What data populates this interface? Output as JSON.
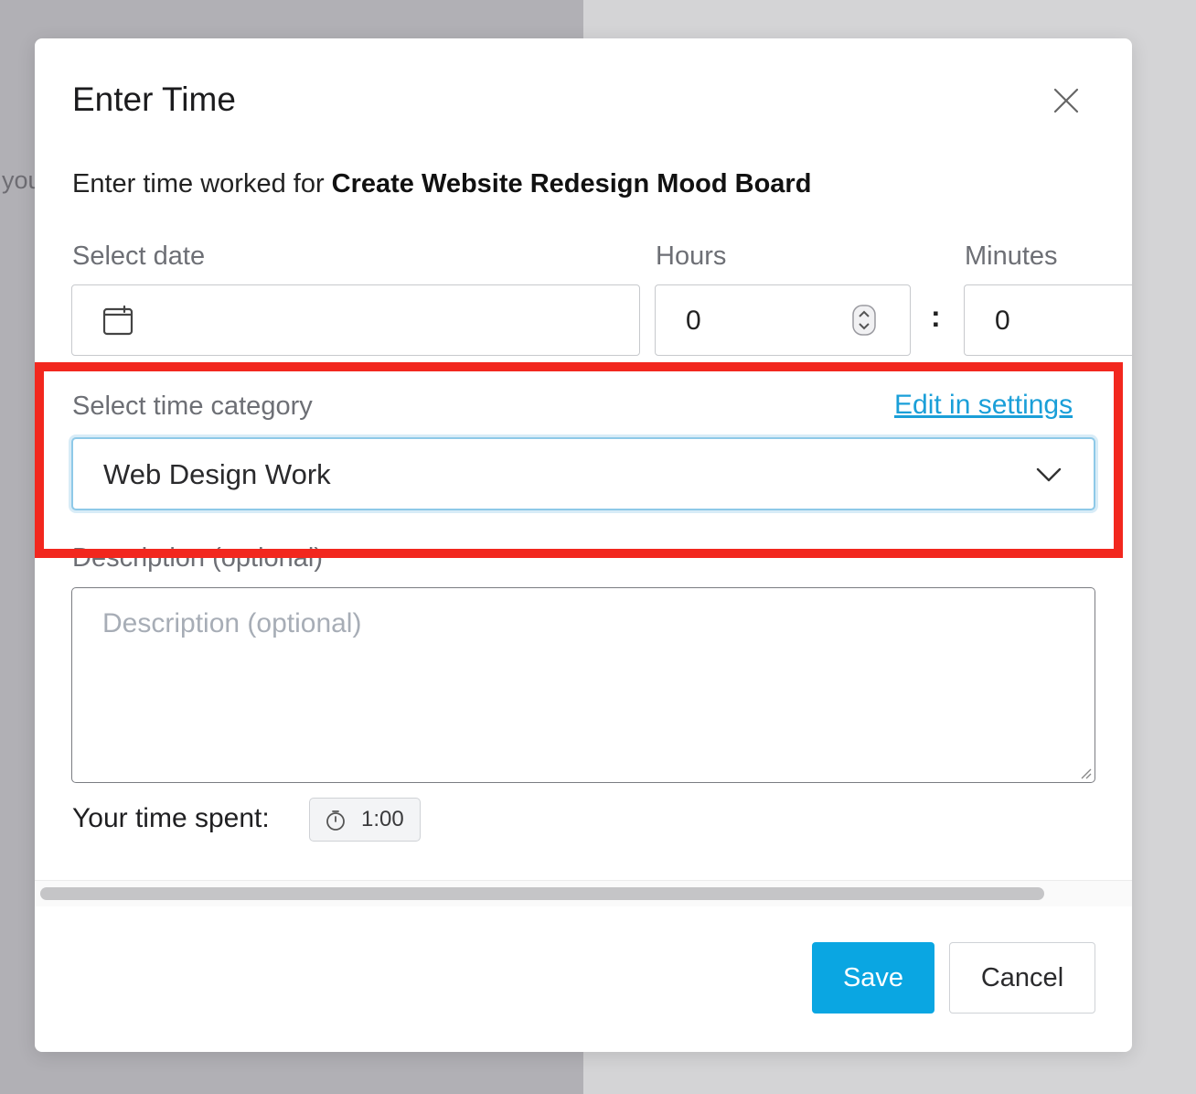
{
  "background": {
    "partial_text": "you"
  },
  "modal": {
    "title": "Enter Time",
    "subtitle_prefix": "Enter time worked for ",
    "task_name": "Create Website Redesign Mood Board",
    "date": {
      "label": "Select date",
      "value": ""
    },
    "hours": {
      "label": "Hours",
      "value": "0"
    },
    "separator": ":",
    "minutes": {
      "label": "Minutes",
      "value": "0"
    },
    "category": {
      "label": "Select time category",
      "edit_link": "Edit in settings",
      "selected": "Web Design Work"
    },
    "description": {
      "label": "Description (optional)",
      "placeholder": "Description (optional)"
    },
    "time_spent": {
      "label": "Your time spent:",
      "value": "1:00"
    },
    "buttons": {
      "save": "Save",
      "cancel": "Cancel"
    }
  },
  "colors": {
    "accent": "#0aa6e2",
    "link": "#1a9fd8",
    "highlight": "#f2271e"
  }
}
